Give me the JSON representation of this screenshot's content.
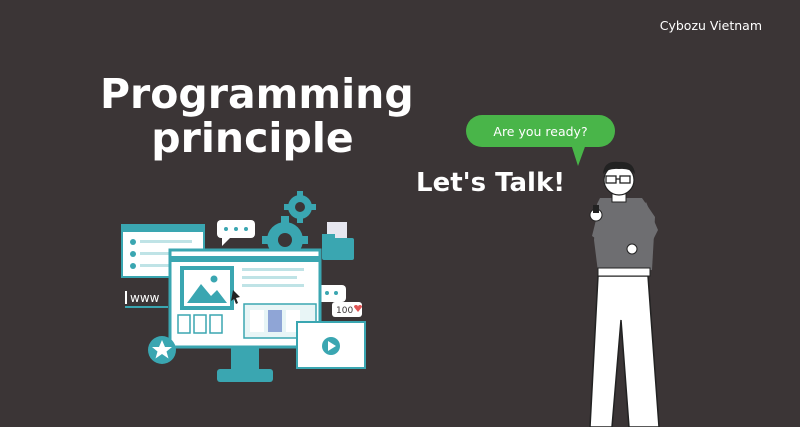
{
  "brand": "Cybozu Vietnam",
  "title": {
    "line1": "Programming",
    "line2": "principle"
  },
  "bubble": "Are you ready?",
  "cta": "Let's Talk!",
  "illustration": {
    "www_label": "www",
    "count_badge": "100"
  },
  "colors": {
    "background": "#3b3536",
    "bubble": "#49b549",
    "teal": "#3aa6b1",
    "light_teal": "#bfe3e6",
    "white": "#ffffff"
  }
}
